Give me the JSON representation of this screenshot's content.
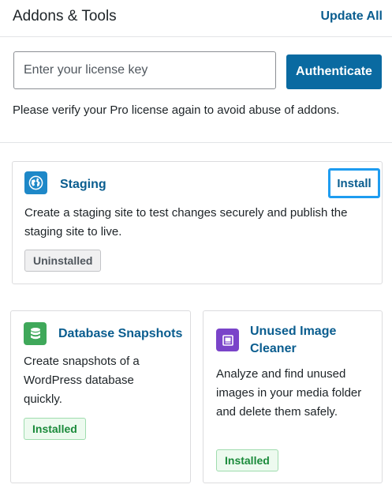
{
  "header": {
    "title": "Addons & Tools",
    "update_all_label": "Update All"
  },
  "license": {
    "placeholder": "Enter your license key",
    "value": "",
    "authenticate_label": "Authenticate",
    "note": "Please verify your Pro license again to avoid abuse of addons."
  },
  "addons": [
    {
      "name": "Staging",
      "icon": "globe-icon",
      "icon_color": "#1e88c8",
      "description": "Create a staging site to test changes securely and publish the staging site to live.",
      "status": "Uninstalled",
      "action_label": "Install"
    },
    {
      "name": "Database Snapshots",
      "icon": "database-icon",
      "icon_color": "#3fa85a",
      "description": "Create snapshots of a WordPress database quickly.",
      "status": "Installed"
    },
    {
      "name": "Unused Image Cleaner",
      "icon": "image-cleaner-icon",
      "icon_color": "#7a44c9",
      "description": "Analyze and find unused images in your media folder and delete them safely.",
      "status": "Installed"
    }
  ],
  "colors": {
    "accent": "#0a6aa1",
    "link": "#0a5d8f",
    "focus_outline": "#1e9cf0",
    "installed_green": "#1a8a3a"
  }
}
